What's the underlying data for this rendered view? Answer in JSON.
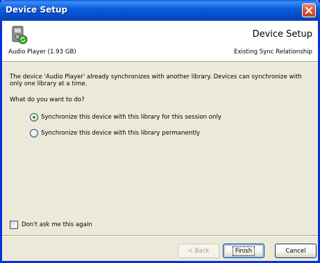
{
  "window": {
    "title": "Device Setup"
  },
  "header": {
    "title": "Device Setup",
    "device": "Audio Player (1.93 GB)",
    "subtitle": "Existing Sync Relationship",
    "icon": "device-sync-icon"
  },
  "body": {
    "message": "The device 'Audio Player' already synchronizes with another library. Devices can synchronize with only one library at a time.",
    "question": "What do you want to do?",
    "options": [
      {
        "label": "Synchronize this device with this library for this session only",
        "checked": true
      },
      {
        "label": "Synchronize this device with this library permanently",
        "checked": false
      }
    ],
    "dont_ask": {
      "label": "Don't ask me this again",
      "checked": false
    }
  },
  "buttons": {
    "back": "< Back",
    "finish": "Finish",
    "cancel": "Cancel"
  },
  "colors": {
    "titlebar": "#0a5fdc",
    "close": "#d9542f",
    "face": "#ece9d8",
    "radio_dot": "#21a121"
  }
}
